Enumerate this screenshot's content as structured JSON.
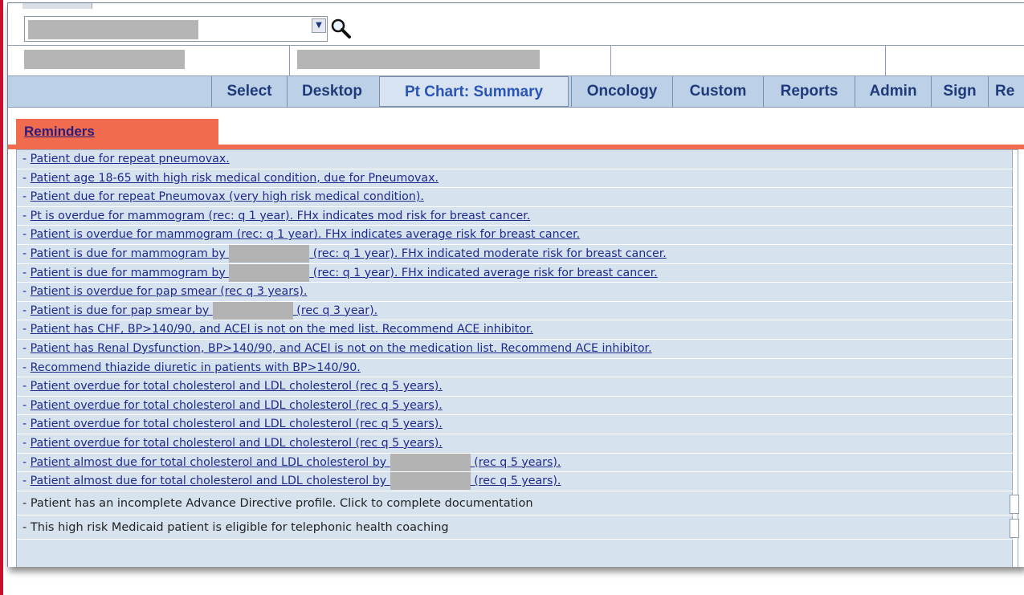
{
  "colors": {
    "accent_left_bar": "#c8102e",
    "nav_background": "#bcd1e8",
    "active_nav": "#d7e3f1",
    "tab_orange": "#f16b4f",
    "list_background": "#d6e3ef",
    "link_blue": "#1f2a8a"
  },
  "patient_select": {
    "value": "",
    "dropdown_icon": "chevron-down-icon",
    "search_icon": "magnifier-icon"
  },
  "nav": {
    "items": [
      {
        "label": "Select"
      },
      {
        "label": "Desktop"
      },
      {
        "label": "Pt Chart: Summary",
        "active": true
      },
      {
        "label": "Oncology"
      },
      {
        "label": "Custom"
      },
      {
        "label": "Reports"
      },
      {
        "label": "Admin"
      },
      {
        "label": "Sign"
      },
      {
        "label": "Re"
      }
    ]
  },
  "tab": {
    "label": "Reminders"
  },
  "reminders": [
    {
      "prefix": "- ",
      "text": "Patient due for repeat pneumovax."
    },
    {
      "prefix": "- ",
      "text": "Patient age 18-65 with high risk medical condition, due for Pneumovax."
    },
    {
      "prefix": "- ",
      "text": "Patient due for repeat Pneumovax (very high risk medical condition)."
    },
    {
      "prefix": "- ",
      "text": "Pt is overdue for mammogram (rec: q 1 year). FHx indicates mod risk for breast cancer."
    },
    {
      "prefix": "- ",
      "text": "Patient is overdue for mammogram (rec: q 1 year). FHx indicates average risk for breast cancer."
    },
    {
      "prefix": "- ",
      "text_a": "Patient is due for mammogram by",
      "text_b": "(rec: q 1 year). FHx indicated moderate risk for breast cancer."
    },
    {
      "prefix": "- ",
      "text_a": "Patient is due for mammogram by",
      "text_b": "(rec: q 1 year). FHx indicated average risk for breast cancer."
    },
    {
      "prefix": "- ",
      "text": "Patient is overdue for pap smear (rec q 3 years)."
    },
    {
      "prefix": "- ",
      "text_a": "Patient is due for pap smear by",
      "text_b": "(rec q 3 year)."
    },
    {
      "prefix": "- ",
      "text": "Patient has CHF, BP>140/90, and ACEI is not on the med list. Recommend ACE inhibitor."
    },
    {
      "prefix": "- ",
      "text": "Patient has Renal Dysfunction, BP>140/90, and ACEI is not on the medication list. Recommend ACE inhibitor."
    },
    {
      "prefix": "- ",
      "text": "Recommend thiazide diuretic in patients with BP>140/90."
    },
    {
      "prefix": "- ",
      "text": "Patient overdue for total cholesterol and LDL cholesterol (rec q 5 years)."
    },
    {
      "prefix": "- ",
      "text": "Patient overdue for total cholesterol and LDL cholesterol (rec q 5 years)."
    },
    {
      "prefix": "- ",
      "text": "Patient overdue for total cholesterol and LDL cholesterol (rec q 5 years)."
    },
    {
      "prefix": "- ",
      "text": "Patient overdue for total cholesterol and LDL cholesterol (rec q 5 years)."
    },
    {
      "prefix": "- ",
      "text_a": "Patient almost due for total cholesterol and LDL cholesterol by",
      "text_b": "(rec q 5 years)."
    },
    {
      "prefix": "- ",
      "text_a": "Patient almost due for total cholesterol and LDL cholesterol by",
      "text_b": "(rec q 5 years)."
    },
    {
      "prefix": "- ",
      "text": "Patient has an incomplete Advance Directive profile. Click to complete documentation"
    },
    {
      "prefix": "- ",
      "text": "This high risk Medicaid patient is eligible for telephonic health coaching"
    }
  ]
}
